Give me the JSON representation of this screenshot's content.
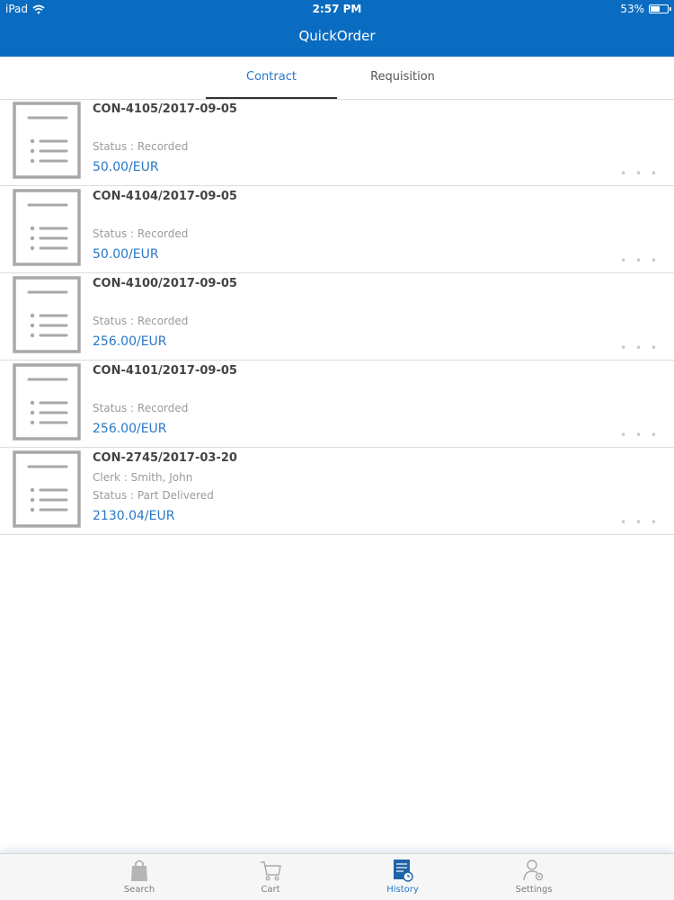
{
  "status_bar": {
    "device": "iPad",
    "time": "2:57 PM",
    "battery": "53%",
    "battery_level": 0.53
  },
  "header": {
    "title": "QuickOrder"
  },
  "tabs": [
    {
      "label": "Contract",
      "active": true
    },
    {
      "label": "Requisition",
      "active": false
    }
  ],
  "contracts": [
    {
      "title": "CON-4105/2017-09-05",
      "clerk": "",
      "status": "Status : Recorded",
      "amount": "50.00/EUR",
      "more": "• • •"
    },
    {
      "title": "CON-4104/2017-09-05",
      "clerk": "",
      "status": "Status : Recorded",
      "amount": "50.00/EUR",
      "more": "• • •"
    },
    {
      "title": "CON-4100/2017-09-05",
      "clerk": "",
      "status": "Status : Recorded",
      "amount": "256.00/EUR",
      "more": "• • •"
    },
    {
      "title": "CON-4101/2017-09-05",
      "clerk": "",
      "status": "Status : Recorded",
      "amount": "256.00/EUR",
      "more": "• • •"
    },
    {
      "title": "CON-2745/2017-03-20",
      "clerk": "Clerk : Smith, John",
      "status": "Status : Part Delivered",
      "amount": "2130.04/EUR",
      "more": "• • •"
    }
  ],
  "tabbar": [
    {
      "label": "Search",
      "icon": "shopping-bag-icon",
      "active": false
    },
    {
      "label": "Cart",
      "icon": "cart-icon",
      "active": false
    },
    {
      "label": "History",
      "icon": "history-icon",
      "active": true
    },
    {
      "label": "Settings",
      "icon": "settings-user-icon",
      "active": false
    }
  ],
  "colors": {
    "header_bg": "#0a6cc0",
    "accent": "#2878c8",
    "icon_gray": "#a8a8a8"
  }
}
